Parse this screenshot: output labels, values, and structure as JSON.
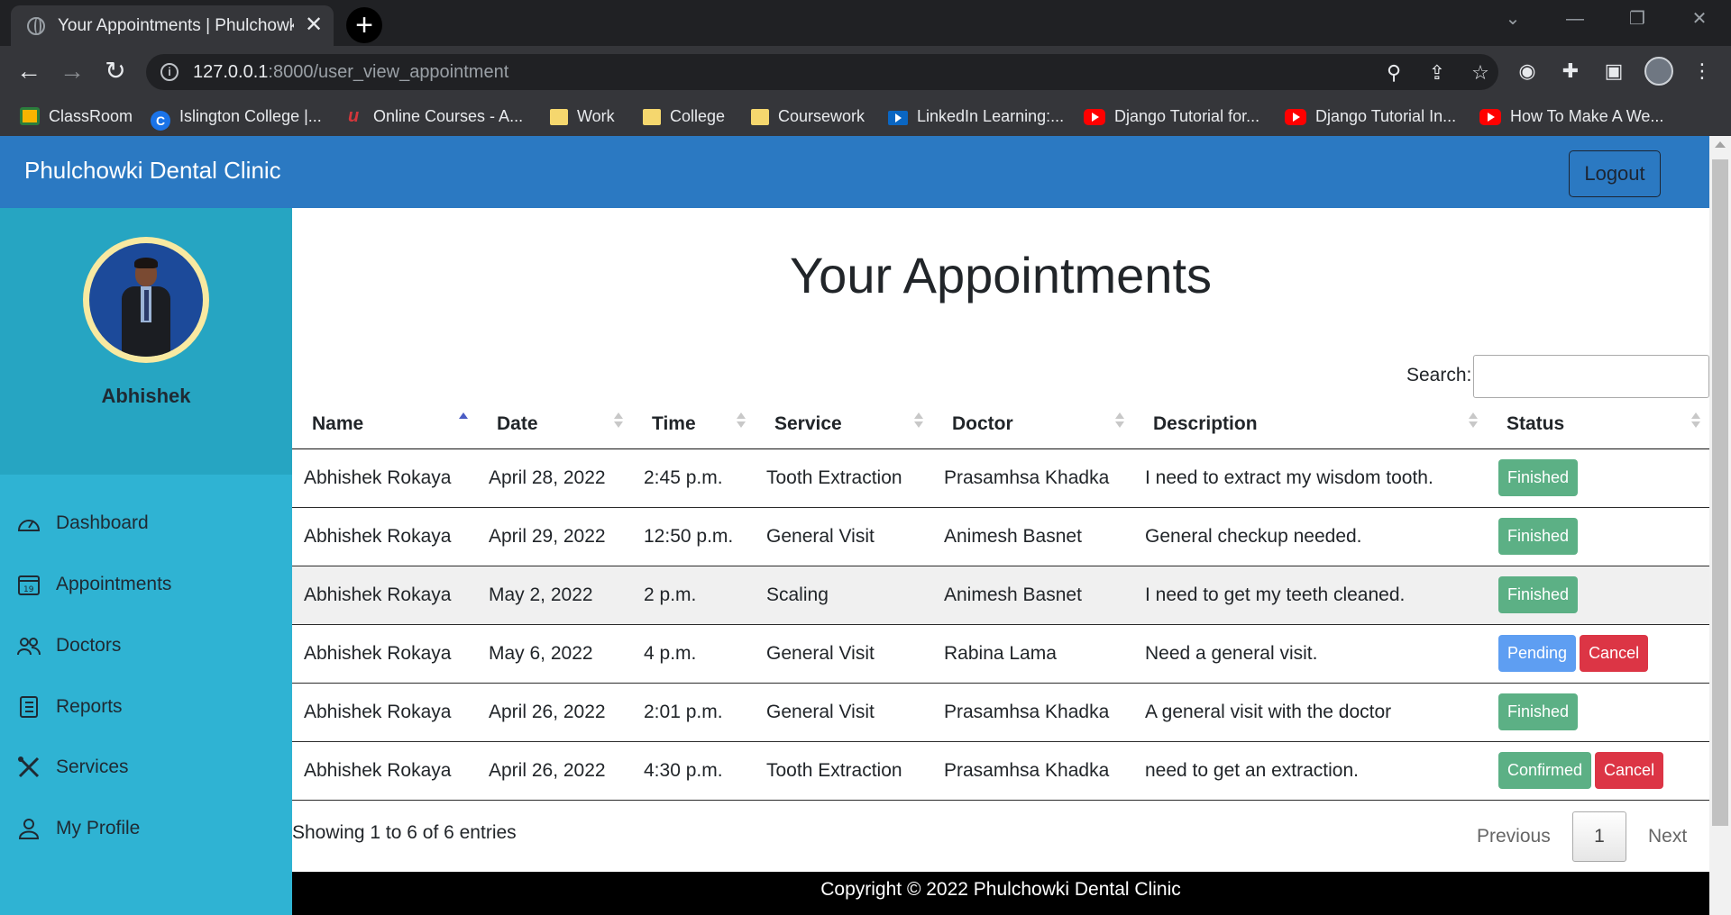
{
  "browser": {
    "tab_title": "Your Appointments | Phulchowki Dental Clinic",
    "tab_close": "✕",
    "new_tab": "+",
    "url_host": "127.0.0.1",
    "url_path": ":8000/user_view_appointment",
    "window_buttons": [
      "⌄",
      "—",
      "❐",
      "✕"
    ],
    "bookmarks": [
      {
        "label": "ClassRoom",
        "icon": "classroom-icon"
      },
      {
        "label": "Islington College |...",
        "icon": "college-icon"
      },
      {
        "label": "Online Courses - A...",
        "icon": "udemy-icon"
      },
      {
        "label": "Work",
        "icon": "folder-icon"
      },
      {
        "label": "College",
        "icon": "folder-icon"
      },
      {
        "label": "Coursework",
        "icon": "folder-icon"
      },
      {
        "label": "LinkedIn Learning:...",
        "icon": "linkedin-icon"
      },
      {
        "label": "Django Tutorial for...",
        "icon": "youtube-icon"
      },
      {
        "label": "Django Tutorial In...",
        "icon": "youtube-icon"
      },
      {
        "label": "How To Make A We...",
        "icon": "youtube-icon"
      }
    ]
  },
  "navbar": {
    "brand": "Phulchowki Dental Clinic",
    "logout_label": "Logout",
    "color": "#2b79c2"
  },
  "sidebar": {
    "user_name": "Abhishek",
    "items": [
      {
        "label": "Dashboard",
        "icon": "dashboard-icon"
      },
      {
        "label": "Appointments",
        "icon": "calendar-icon"
      },
      {
        "label": "Doctors",
        "icon": "users-icon"
      },
      {
        "label": "Reports",
        "icon": "reports-icon"
      },
      {
        "label": "Services",
        "icon": "tools-icon"
      },
      {
        "label": "My Profile",
        "icon": "user-icon"
      }
    ]
  },
  "main": {
    "title": "Your Appointments",
    "search_label": "Search:",
    "search_value": "",
    "columns": [
      "Name",
      "Date",
      "Time",
      "Service",
      "Doctor",
      "Description",
      "Status"
    ],
    "rows": [
      {
        "name": "Abhishek Rokaya",
        "date": "April 28, 2022",
        "time": "2:45 p.m.",
        "service": "Tooth Extraction",
        "doctor": "Prasamhsa Khadka",
        "description": "I need to extract my wisdom tooth.",
        "status": "Finished",
        "cancel": ""
      },
      {
        "name": "Abhishek Rokaya",
        "date": "April 29, 2022",
        "time": "12:50 p.m.",
        "service": "General Visit",
        "doctor": "Animesh Basnet",
        "description": "General checkup needed.",
        "status": "Finished",
        "cancel": ""
      },
      {
        "name": "Abhishek Rokaya",
        "date": "May 2, 2022",
        "time": "2 p.m.",
        "service": "Scaling",
        "doctor": "Animesh Basnet",
        "description": "I need to get my teeth cleaned.",
        "status": "Finished",
        "cancel": ""
      },
      {
        "name": "Abhishek Rokaya",
        "date": "May 6, 2022",
        "time": "4 p.m.",
        "service": "General Visit",
        "doctor": "Rabina Lama",
        "description": "Need a general visit.",
        "status": "Pending",
        "cancel": "Cancel"
      },
      {
        "name": "Abhishek Rokaya",
        "date": "April 26, 2022",
        "time": "2:01 p.m.",
        "service": "General Visit",
        "doctor": "Prasamhsa Khadka",
        "description": "A general visit with the doctor",
        "status": "Finished",
        "cancel": ""
      },
      {
        "name": "Abhishek Rokaya",
        "date": "April 26, 2022",
        "time": "4:30 p.m.",
        "service": "Tooth Extraction",
        "doctor": "Prasamhsa Khadka",
        "description": "need to get an extraction.",
        "status": "Confirmed",
        "cancel": "Cancel"
      }
    ],
    "info": "Showing 1 to 6 of 6 entries",
    "pagination": {
      "previous": "Previous",
      "current": "1",
      "next": "Next"
    }
  },
  "footer": {
    "text": "Copyright © 2022 Phulchowki Dental Clinic"
  },
  "colors": {
    "finished": "#5cb085",
    "pending": "#5e9ef2",
    "cancel": "#dc3545",
    "sidebar": "#2fb3d3"
  }
}
